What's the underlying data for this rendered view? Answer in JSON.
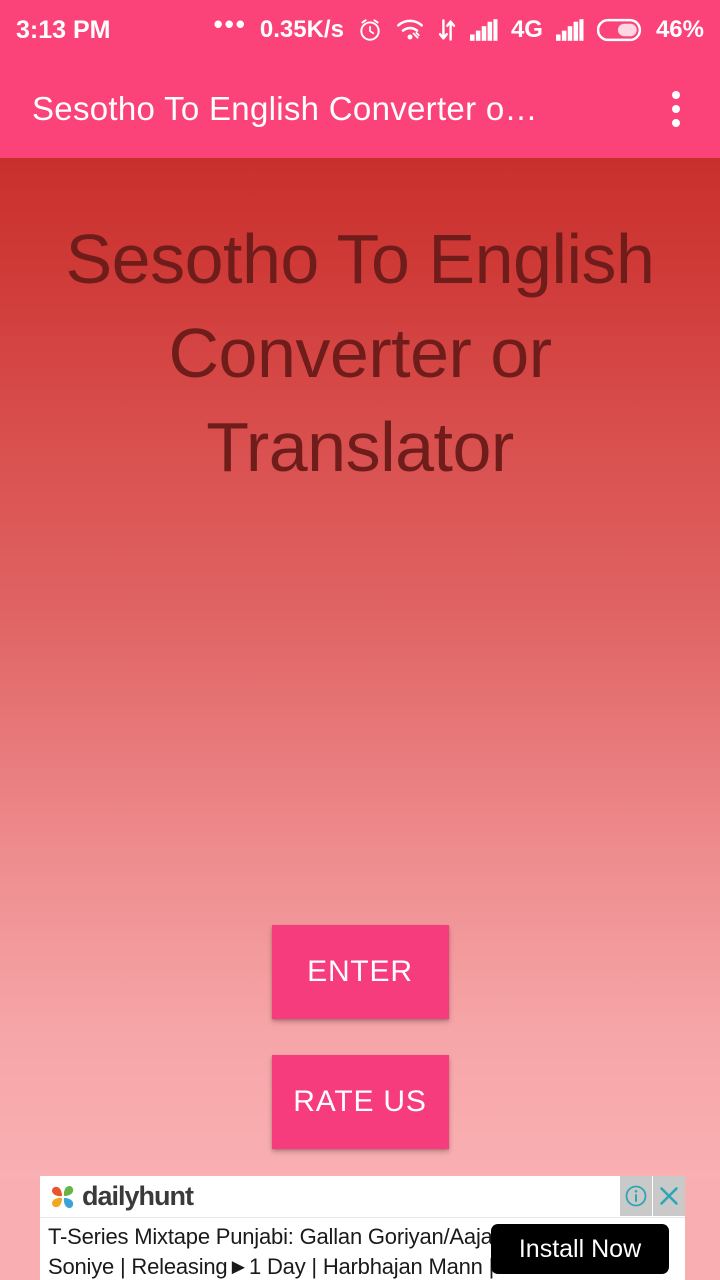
{
  "status_bar": {
    "time": "3:13 PM",
    "network_speed": "0.35K/s",
    "battery_percent": "46%",
    "network_type": "4G",
    "icons": [
      "more-dots-icon",
      "alarm-clock-icon",
      "wifi-icon",
      "data-transfer-icon",
      "signal-bars-icon",
      "signal-bars-2-icon",
      "battery-icon"
    ],
    "background_color": "#FB4379"
  },
  "app_bar": {
    "title": "Sesotho To English Converter o…",
    "overflow_label": "overflow-menu",
    "background_color": "#FB4379",
    "title_color": "#FFFFFF"
  },
  "main": {
    "headline": "Sesotho To English Converter or Translator",
    "headline_color": "#6F1D1B",
    "gradient_top": "#C8302D",
    "gradient_bottom": "#F9B0B2",
    "buttons": [
      {
        "label": "ENTER",
        "name": "enter-button",
        "color": "#F73C7E"
      },
      {
        "label": "RATE US",
        "name": "rate-us-button",
        "color": "#F73C7E"
      }
    ]
  },
  "ad": {
    "network_name": "dailyhunt",
    "headline": "T-Series Mixtape Punjabi: Gallan Goriyan/Aaja Soniye | Releasing►1 Day | Harbhajan Mann | Akriti Kak",
    "cta_label": "Install Now",
    "info_label": "i",
    "close_label": "×",
    "cta_background": "#000000",
    "control_color": "#2BA8B4"
  }
}
